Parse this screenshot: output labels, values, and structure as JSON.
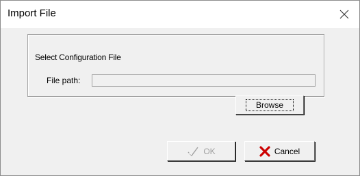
{
  "window": {
    "title": "Import File"
  },
  "group": {
    "legend": "Select Configuration File"
  },
  "file_path": {
    "label": "File path:",
    "value": ""
  },
  "buttons": {
    "browse": "Browse",
    "ok": "OK",
    "cancel": "Cancel"
  },
  "icons": {
    "close": "close-icon",
    "ok": "check-icon",
    "cancel": "x-mark-icon"
  },
  "colors": {
    "cancel_icon": "#cc0000",
    "disabled_text": "#a0a0a0",
    "dialog_bg": "#f0f0f0"
  }
}
